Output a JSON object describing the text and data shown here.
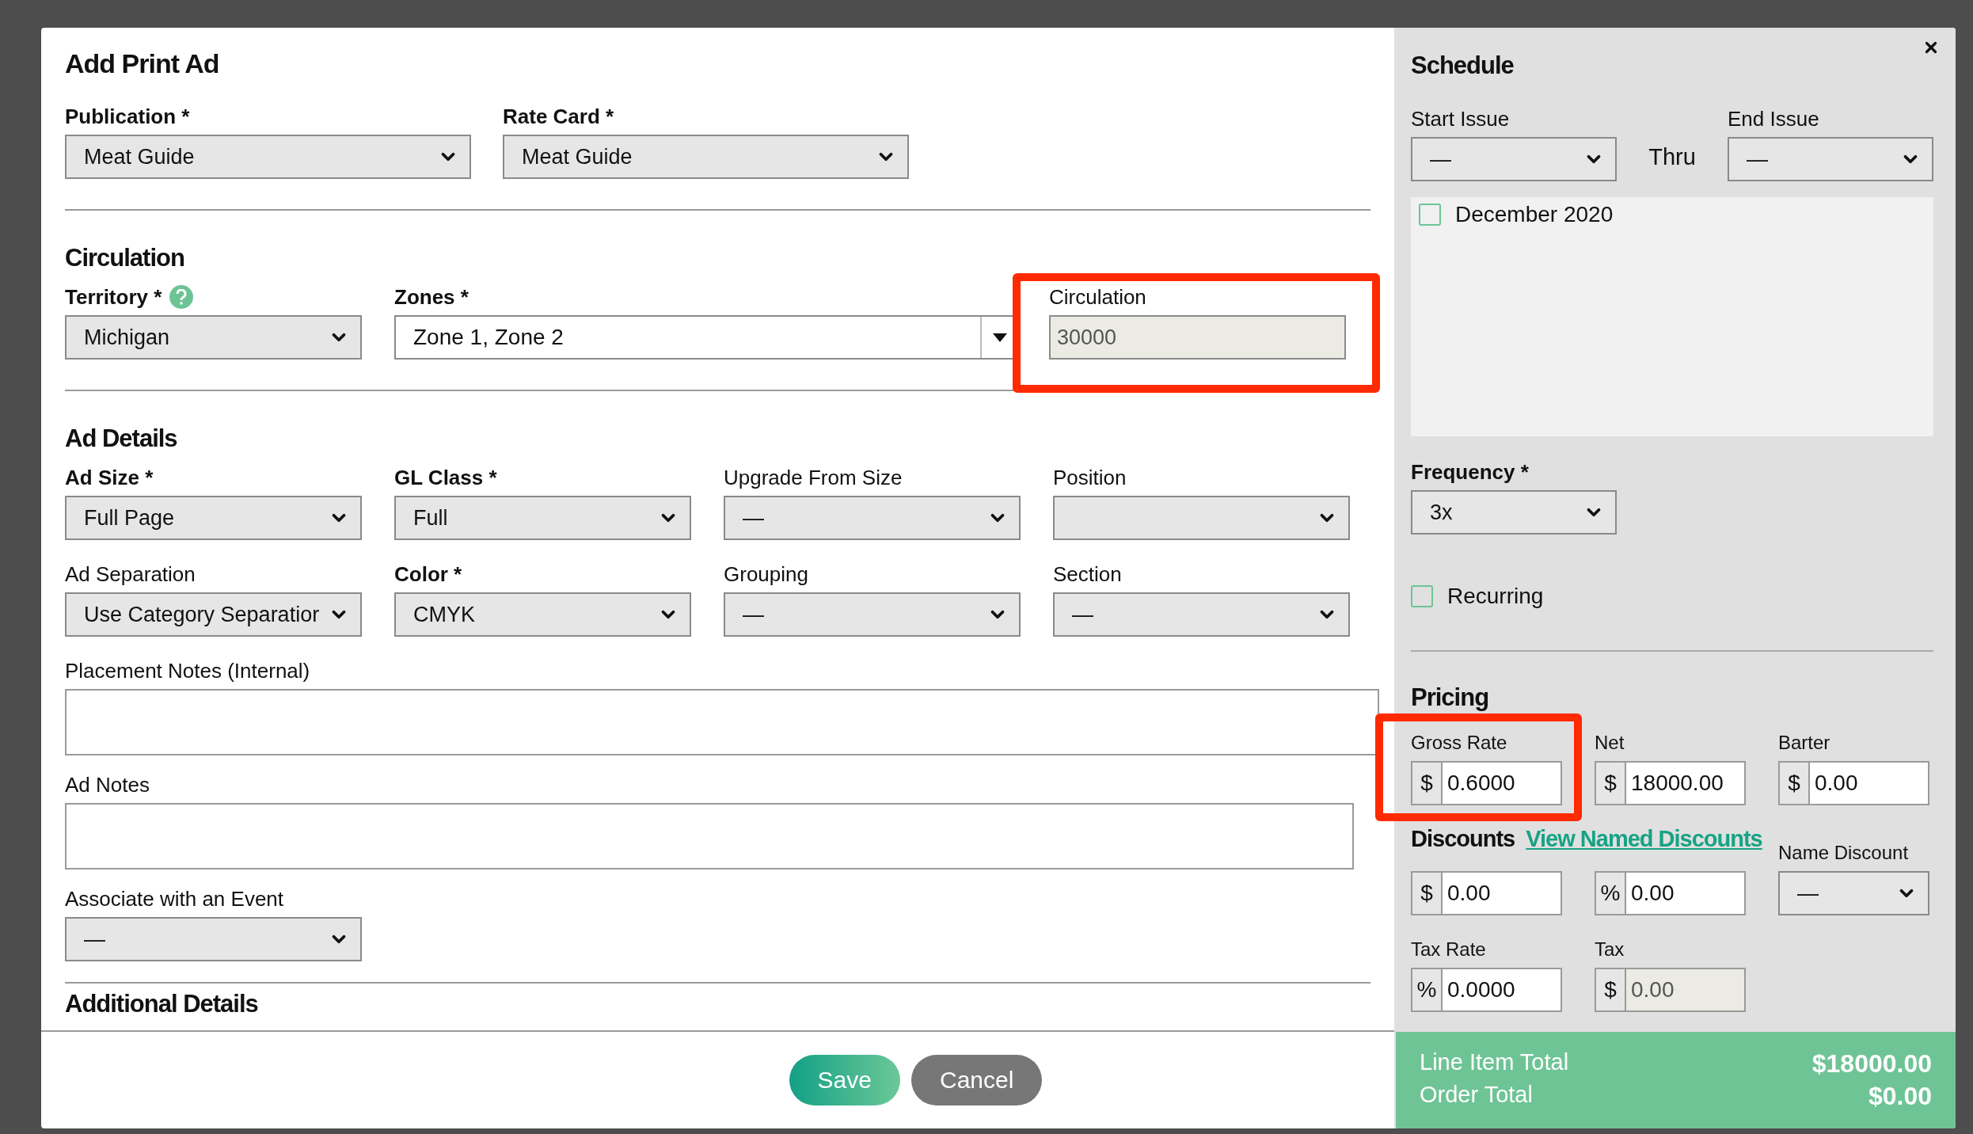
{
  "title": "Add Print Ad",
  "publication_row": [
    {
      "label": "Publication *",
      "required": true,
      "value": "Meat Guide"
    },
    {
      "label": "Rate Card *",
      "required": true,
      "value": "Meat Guide"
    }
  ],
  "circulation": {
    "heading": "Circulation",
    "fields": [
      {
        "kind": "select",
        "label": "Territory *",
        "required": true,
        "help": true,
        "value": "Michigan"
      },
      {
        "kind": "multiselect",
        "label": "Zones *",
        "required": true,
        "value": "Zone 1, Zone 2"
      },
      {
        "kind": "readonly",
        "label": "Circulation",
        "required": false,
        "value": "30000",
        "highlighted": true
      }
    ]
  },
  "ad_details": {
    "heading": "Ad Details",
    "fields": [
      {
        "label": "Ad Size *",
        "required": true,
        "value": "Full Page"
      },
      {
        "label": "GL Class *",
        "required": true,
        "value": "Full"
      },
      {
        "label": "Upgrade From Size",
        "required": false,
        "value": "—"
      },
      {
        "label": "Position",
        "required": false
      },
      {
        "label": "Ad Separation",
        "required": false,
        "value": "Use Category Separatior"
      },
      {
        "label": "Color *",
        "required": true,
        "value": "CMYK"
      },
      {
        "label": "Grouping",
        "required": false,
        "value": "—"
      },
      {
        "label": "Section",
        "required": false,
        "value": "—"
      }
    ],
    "notes": [
      {
        "label": "Placement Notes (Internal)",
        "wide": true
      },
      {
        "label": "Ad Notes",
        "wide": false
      }
    ],
    "event": {
      "label": "Associate with an Event",
      "value": "—"
    }
  },
  "additional_details": {
    "heading": "Additional Details"
  },
  "footer_buttons": [
    {
      "kind": "primary",
      "label": "Save"
    },
    {
      "kind": "secondary",
      "label": "Cancel"
    }
  ],
  "schedule": {
    "heading": "Schedule",
    "start": {
      "label": "Start Issue",
      "value": "—"
    },
    "thru": "Thru",
    "end": {
      "label": "End Issue",
      "value": "—"
    },
    "issues": [
      {
        "label": "December 2020",
        "checked": false
      }
    ],
    "frequency": {
      "label": "Frequency *",
      "value": "3x"
    },
    "recurring": {
      "label": "Recurring",
      "checked": false
    }
  },
  "pricing": {
    "heading": "Pricing",
    "fields": [
      {
        "label": "Gross Rate",
        "prefix": "$",
        "value": "0.6000",
        "highlighted": true
      },
      {
        "label": "Net",
        "prefix": "$",
        "value": "18000.00"
      },
      {
        "label": "Barter",
        "prefix": "$",
        "value": "0.00"
      }
    ],
    "discounts_heading": "Discounts",
    "discounts_link": "View Named Discounts",
    "discount_fields": [
      {
        "prefix": "$",
        "value": "0.00"
      },
      {
        "prefix": "%",
        "value": "0.00"
      }
    ],
    "name_discount": {
      "label": "Name Discount",
      "value": "—"
    },
    "tax_fields": [
      {
        "label": "Tax Rate",
        "prefix": "%",
        "value": "0.0000",
        "disabled": false
      },
      {
        "label": "Tax",
        "prefix": "$",
        "value": "0.00",
        "disabled": true
      }
    ]
  },
  "totals": [
    {
      "label": "Line Item Total",
      "value": "$18000.00"
    },
    {
      "label": "Order Total",
      "value": "$0.00"
    }
  ]
}
